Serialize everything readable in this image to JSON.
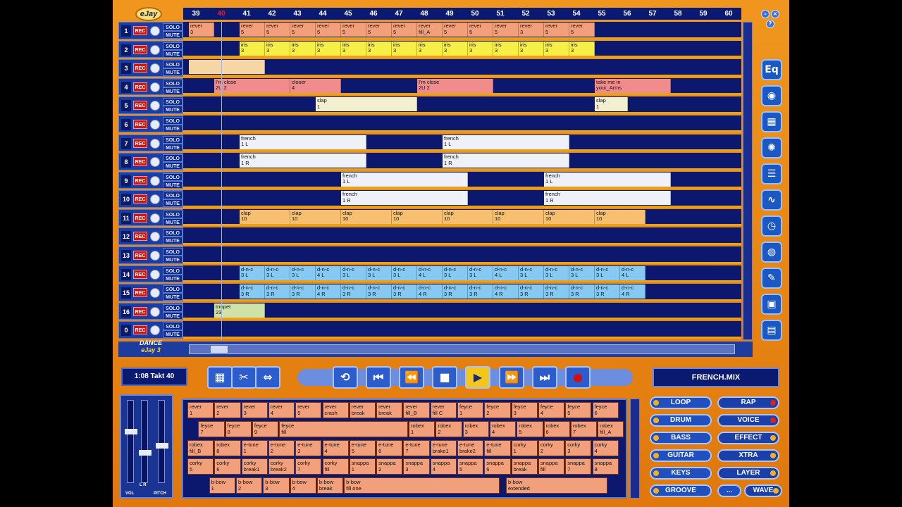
{
  "app": {
    "logo": "eJay",
    "brand_top": "DANCE",
    "brand_mid": "eJay",
    "brand_num": "3"
  },
  "bars": [
    {
      "label": "39",
      "current": false
    },
    {
      "label": "40",
      "current": true
    },
    {
      "label": "41",
      "current": false
    },
    {
      "label": "42",
      "current": false
    },
    {
      "label": "43",
      "current": false
    },
    {
      "label": "44",
      "current": false
    },
    {
      "label": "45",
      "current": false
    },
    {
      "label": "46",
      "current": false
    },
    {
      "label": "47",
      "current": false
    },
    {
      "label": "48",
      "current": false
    },
    {
      "label": "49",
      "current": false
    },
    {
      "label": "50",
      "current": false
    },
    {
      "label": "51",
      "current": false
    },
    {
      "label": "52",
      "current": false
    },
    {
      "label": "53",
      "current": false
    },
    {
      "label": "54",
      "current": false
    },
    {
      "label": "55",
      "current": false
    },
    {
      "label": "56",
      "current": false
    },
    {
      "label": "57",
      "current": false
    },
    {
      "label": "58",
      "current": false
    },
    {
      "label": "59",
      "current": false
    },
    {
      "label": "60",
      "current": false
    }
  ],
  "track_ui": {
    "rec": "REC",
    "solo": "SOLO",
    "mute": "MUTE"
  },
  "tracks": [
    {
      "num": "1",
      "clips": [
        [
          "rever\n3",
          0,
          1,
          "c-rev"
        ],
        [
          "rever\n5",
          2,
          1,
          "c-rev"
        ],
        [
          "rever\n5",
          3,
          1,
          "c-rev"
        ],
        [
          "rever\n5",
          4,
          1,
          "c-rev"
        ],
        [
          "rever\n5",
          5,
          1,
          "c-rev"
        ],
        [
          "rever\n5",
          6,
          1,
          "c-rev"
        ],
        [
          "rever\n5",
          7,
          1,
          "c-rev"
        ],
        [
          "rever\n5",
          8,
          1,
          "c-rev"
        ],
        [
          "rever\nfill_A",
          9,
          1,
          "c-rev"
        ],
        [
          "rever\n5",
          10,
          1,
          "c-rev"
        ],
        [
          "rever\n5",
          11,
          1,
          "c-rev"
        ],
        [
          "rever\n5",
          12,
          1,
          "c-rev"
        ],
        [
          "rever\n3",
          13,
          1,
          "c-rev"
        ],
        [
          "rever\n5",
          14,
          1,
          "c-rev"
        ],
        [
          "rever\n5",
          15,
          1,
          "c-rev"
        ]
      ]
    },
    {
      "num": "2",
      "clips": [
        [
          "iris\n3",
          2,
          1,
          "c-iris"
        ],
        [
          "iris\n3",
          3,
          1,
          "c-iris"
        ],
        [
          "iris\n3",
          4,
          1,
          "c-iris"
        ],
        [
          "iris\n3",
          5,
          1,
          "c-iris"
        ],
        [
          "iris\n3",
          6,
          1,
          "c-iris"
        ],
        [
          "iris\n3",
          7,
          1,
          "c-iris"
        ],
        [
          "iris\n3",
          8,
          1,
          "c-iris"
        ],
        [
          "iris\n3",
          9,
          1,
          "c-iris"
        ],
        [
          "iris\n3",
          10,
          1,
          "c-iris"
        ],
        [
          "iris\n3",
          11,
          1,
          "c-iris"
        ],
        [
          "iris\n3",
          12,
          1,
          "c-iris"
        ],
        [
          "iris\n3",
          13,
          1,
          "c-iris"
        ],
        [
          "iris\n3",
          14,
          1,
          "c-iris"
        ],
        [
          "iris\n3",
          15,
          1,
          "c-iris"
        ]
      ]
    },
    {
      "num": "3",
      "clips": [
        [
          "",
          0,
          3,
          "c-peach"
        ]
      ]
    },
    {
      "num": "4",
      "clips": [
        [
          "I'm close\n2U 2",
          1,
          3,
          "c-close"
        ],
        [
          "closer\n4",
          4,
          2,
          "c-close"
        ],
        [
          "I'm close\n2U 2",
          9,
          3,
          "c-close"
        ],
        [
          "take me in\nyour_Arms",
          16,
          3,
          "c-close"
        ]
      ]
    },
    {
      "num": "5",
      "clips": [
        [
          "slap\n1",
          5,
          4,
          "c-slap"
        ],
        [
          "slap\n1",
          16,
          1.3,
          "c-slap"
        ]
      ]
    },
    {
      "num": "6",
      "clips": []
    },
    {
      "num": "7",
      "clips": [
        [
          "french\n1 L",
          2,
          5,
          "c-french"
        ],
        [
          "french\n1 L",
          10,
          5,
          "c-french"
        ]
      ]
    },
    {
      "num": "8",
      "clips": [
        [
          "french\n1 R",
          2,
          5,
          "c-french"
        ],
        [
          "french\n1 R",
          10,
          5,
          "c-french"
        ]
      ]
    },
    {
      "num": "9",
      "clips": [
        [
          "french\n1 L",
          6,
          5,
          "c-french"
        ],
        [
          "french\n1 L",
          14,
          5,
          "c-french"
        ]
      ]
    },
    {
      "num": "10",
      "clips": [
        [
          "french\n1 R",
          6,
          5,
          "c-french"
        ],
        [
          "french\n1 R",
          14,
          5,
          "c-french"
        ]
      ]
    },
    {
      "num": "11",
      "clips": [
        [
          "clap\n10",
          2,
          2,
          "c-clap"
        ],
        [
          "clap\n10",
          4,
          2,
          "c-clap"
        ],
        [
          "clap\n10",
          6,
          2,
          "c-clap"
        ],
        [
          "clap\n10",
          8,
          2,
          "c-clap"
        ],
        [
          "clap\n10",
          10,
          2,
          "c-clap"
        ],
        [
          "clap\n10",
          12,
          2,
          "c-clap"
        ],
        [
          "clap\n10",
          14,
          2,
          "c-clap"
        ],
        [
          "clap\n10",
          16,
          2,
          "c-clap"
        ]
      ]
    },
    {
      "num": "12",
      "clips": []
    },
    {
      "num": "13",
      "clips": []
    },
    {
      "num": "14",
      "clips": [
        [
          "d-n-c\n3 L",
          2,
          1,
          "c-dnc"
        ],
        [
          "d-n-c\n3 L",
          3,
          1,
          "c-dnc"
        ],
        [
          "d-n-c\n3 L",
          4,
          1,
          "c-dnc"
        ],
        [
          "d-n-c\n4 L",
          5,
          1,
          "c-dnc"
        ],
        [
          "d-n-c\n3 L",
          6,
          1,
          "c-dnc"
        ],
        [
          "d-n-c\n3 L",
          7,
          1,
          "c-dnc"
        ],
        [
          "d-n-c\n3 L",
          8,
          1,
          "c-dnc"
        ],
        [
          "d-n-c\n4 L",
          9,
          1,
          "c-dnc"
        ],
        [
          "d-n-c\n3 L",
          10,
          1,
          "c-dnc"
        ],
        [
          "d-n-c\n3 L",
          11,
          1,
          "c-dnc"
        ],
        [
          "d-n-c\n4 L",
          12,
          1,
          "c-dnc"
        ],
        [
          "d-n-c\n3 L",
          13,
          1,
          "c-dnc"
        ],
        [
          "d-n-c\n3 L",
          14,
          1,
          "c-dnc"
        ],
        [
          "d-n-c\n3 L",
          15,
          1,
          "c-dnc"
        ],
        [
          "d-n-c\n3 L",
          16,
          1,
          "c-dnc"
        ],
        [
          "d-n-c\n4 L",
          17,
          1,
          "c-dnc"
        ]
      ]
    },
    {
      "num": "15",
      "clips": [
        [
          "d-n-c\n3 R",
          2,
          1,
          "c-dnc"
        ],
        [
          "d-n-c\n3 R",
          3,
          1,
          "c-dnc"
        ],
        [
          "d-n-c\n3 R",
          4,
          1,
          "c-dnc"
        ],
        [
          "d-n-c\n4 R",
          5,
          1,
          "c-dnc"
        ],
        [
          "d-n-c\n3 R",
          6,
          1,
          "c-dnc"
        ],
        [
          "d-n-c\n3 R",
          7,
          1,
          "c-dnc"
        ],
        [
          "d-n-c\n3 R",
          8,
          1,
          "c-dnc"
        ],
        [
          "d-n-c\n4 R",
          9,
          1,
          "c-dnc"
        ],
        [
          "d-n-c\n3 R",
          10,
          1,
          "c-dnc"
        ],
        [
          "d-n-c\n3 R",
          11,
          1,
          "c-dnc"
        ],
        [
          "d-n-c\n4 R",
          12,
          1,
          "c-dnc"
        ],
        [
          "d-n-c\n3 R",
          13,
          1,
          "c-dnc"
        ],
        [
          "d-n-c\n3 R",
          14,
          1,
          "c-dnc"
        ],
        [
          "d-n-c\n3 R",
          15,
          1,
          "c-dnc"
        ],
        [
          "d-n-c\n3 R",
          16,
          1,
          "c-dnc"
        ],
        [
          "d-n-c\n4 R",
          17,
          1,
          "c-dnc"
        ]
      ]
    },
    {
      "num": "16",
      "clips": [
        [
          "trmpet\n23",
          1,
          2,
          "c-trump"
        ]
      ]
    },
    {
      "num": "0",
      "clips": []
    }
  ],
  "transport": {
    "time": "1:08 Takt 40",
    "mix_name": "FRENCH.MIX"
  },
  "mixer": {
    "vol": "VOL",
    "lr": "L R",
    "pitch": "PITCH"
  },
  "samples": [
    [
      "rever\n1",
      0,
      0
    ],
    [
      "rever\n2",
      1,
      0
    ],
    [
      "rever\n3",
      2,
      0
    ],
    [
      "rever\n4",
      3,
      0
    ],
    [
      "rever\n5",
      4,
      0
    ],
    [
      "rever\ncrash",
      5,
      0
    ],
    [
      "rever\nbreak",
      6,
      0
    ],
    [
      "rever\nbreak",
      7,
      0
    ],
    [
      "rever\nfill_B",
      8,
      0
    ],
    [
      "rever\nfill C",
      9,
      0
    ],
    [
      "feyce\n1",
      10,
      0
    ],
    [
      "feyce\n2",
      11,
      0
    ],
    [
      "feyce\n3",
      12,
      0
    ],
    [
      "feyce\n4",
      13,
      0
    ],
    [
      "feyce\n5",
      14,
      0
    ],
    [
      "feyce\n6",
      15,
      0
    ],
    [
      "feyce\n7",
      0.4,
      1
    ],
    [
      "feyce\n8",
      1.4,
      1
    ],
    [
      "feyce\n9",
      2.4,
      1
    ],
    [
      "feyce\nfill",
      3.4,
      1,
      4.8
    ],
    [
      "robex\n1",
      8.2,
      1
    ],
    [
      "robex\n2",
      9.2,
      1
    ],
    [
      "robex\n3",
      10.2,
      1
    ],
    [
      "robex\n4",
      11.2,
      1
    ],
    [
      "robex\n5",
      12.2,
      1
    ],
    [
      "robex\n6",
      13.2,
      1
    ],
    [
      "robex\n7",
      14.2,
      1
    ],
    [
      "robex\nfill_A",
      15.2,
      1
    ],
    [
      "robex\nfill_B",
      0,
      2
    ],
    [
      "robex\n8",
      1,
      2
    ],
    [
      "e-tune\n1",
      2,
      2
    ],
    [
      "e-tune\n2",
      3,
      2
    ],
    [
      "e-tune\n3",
      4,
      2
    ],
    [
      "e-tune\n4",
      5,
      2
    ],
    [
      "e-tune\n5",
      6,
      2
    ],
    [
      "e-tune\n6",
      7,
      2
    ],
    [
      "e-tune\n7",
      8,
      2
    ],
    [
      "e-tune\nbrake1",
      9,
      2
    ],
    [
      "e-tune\nbrake2",
      10,
      2
    ],
    [
      "e-tune\nfill",
      11,
      2
    ],
    [
      "corky\n1",
      12,
      2
    ],
    [
      "corky\n2",
      13,
      2
    ],
    [
      "corky\n3",
      14,
      2
    ],
    [
      "corky\n4",
      15,
      2
    ],
    [
      "corky\n5",
      0,
      3
    ],
    [
      "corky\n6",
      1,
      3
    ],
    [
      "corky\nbreak1",
      2,
      3
    ],
    [
      "corky\nbreak2",
      3,
      3
    ],
    [
      "corky\n7",
      4,
      3
    ],
    [
      "corky\nfill",
      5,
      3
    ],
    [
      "snappa\n1",
      6,
      3
    ],
    [
      "snappa\n2",
      7,
      3
    ],
    [
      "snappa\n3",
      8,
      3
    ],
    [
      "snappa\n4",
      9,
      3
    ],
    [
      "snappa\n5",
      10,
      3
    ],
    [
      "snappa\n6",
      11,
      3
    ],
    [
      "snappa\nbreak",
      12,
      3
    ],
    [
      "snappa\nfill",
      13,
      3
    ],
    [
      "snappa\n7",
      14,
      3
    ],
    [
      "snappa\n8",
      15,
      3
    ],
    [
      "b-bow\n1",
      0.8,
      4
    ],
    [
      "b-bow\n2",
      1.8,
      4
    ],
    [
      "b-bow\n3",
      2.8,
      4
    ],
    [
      "b-bow\n4",
      3.8,
      4
    ],
    [
      "b-bow\nbreak",
      4.8,
      4
    ],
    [
      "b-bow\nfill one",
      5.8,
      4,
      5.8
    ],
    [
      "b-bow\nextended",
      11.8,
      4,
      3.8
    ]
  ],
  "categories": [
    {
      "label": "LOOP",
      "side": "left",
      "red": false
    },
    {
      "label": "RAP",
      "side": "right",
      "red": true
    },
    {
      "label": "DRUM",
      "side": "left",
      "red": false
    },
    {
      "label": "VOICE",
      "side": "right",
      "red": true
    },
    {
      "label": "BASS",
      "side": "left",
      "red": false
    },
    {
      "label": "EFFECT",
      "side": "right",
      "red": false
    },
    {
      "label": "GUITAR",
      "side": "left",
      "red": false
    },
    {
      "label": "XTRA",
      "side": "right",
      "red": false
    },
    {
      "label": "KEYS",
      "side": "left",
      "red": false
    },
    {
      "label": "LAYER",
      "side": "right",
      "red": false
    },
    {
      "label": "GROOVE",
      "side": "left",
      "red": false
    },
    {
      "label": "...",
      "side": "mid",
      "red": false
    },
    {
      "label": "WAVE",
      "side": "right",
      "red": false
    }
  ],
  "icons": {
    "tools": [
      "equalizer-icon",
      "effects-icon",
      "grid-icon",
      "spiral-icon",
      "mixer-icon",
      "wave-icon",
      "clock-icon",
      "globe-icon",
      "eraser-icon",
      "save-icon",
      "document-icon"
    ],
    "transport": [
      "loop-toggle-icon",
      "skip-back-icon",
      "rewind-icon",
      "stop-icon",
      "play-icon",
      "fast-forward-icon",
      "skip-forward-icon",
      "record-icon"
    ],
    "edit": [
      "edit-grid-icon",
      "edit-cut-icon",
      "edit-link-icon"
    ]
  }
}
